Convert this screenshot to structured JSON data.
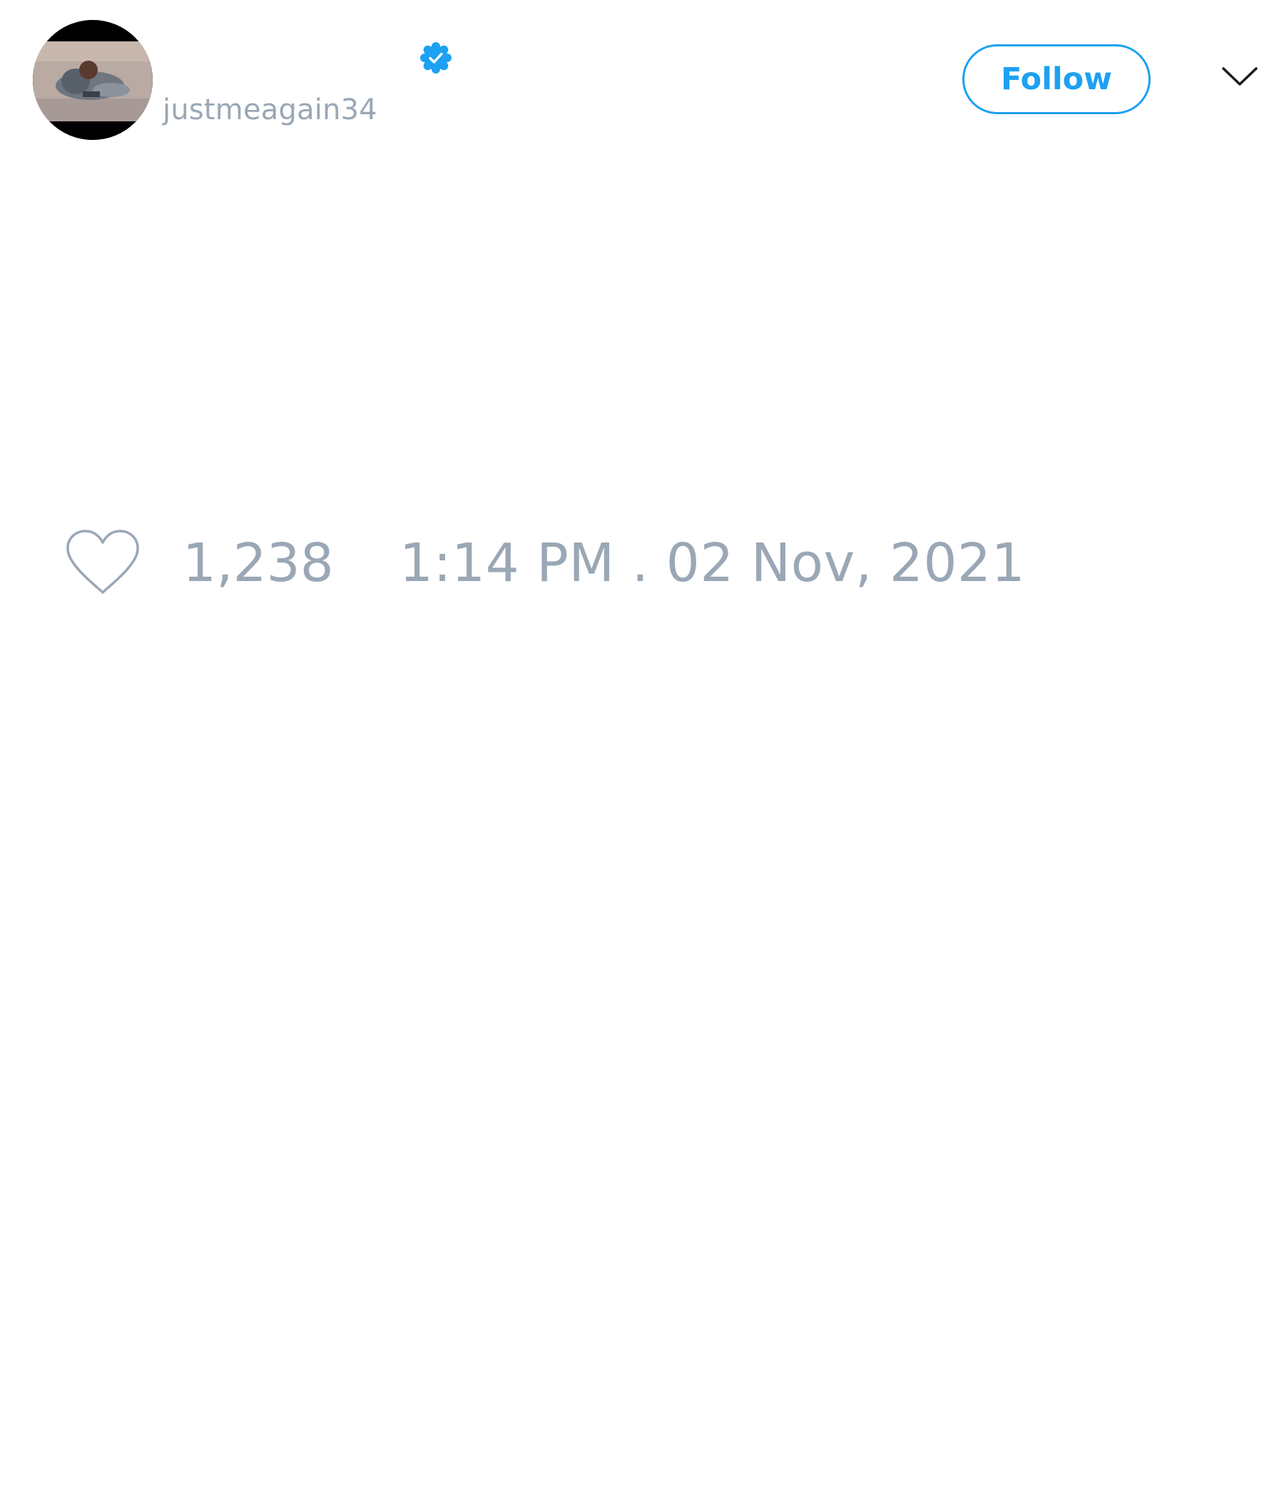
{
  "tweet": {
    "author": {
      "display_name": "",
      "handle": "justmeagain34",
      "verified": true,
      "avatar_icon": "avatar-photo"
    },
    "follow_label": "Follow",
    "menu_icon": "chevron-down-icon",
    "footer": {
      "like_icon": "heart-outline-icon",
      "like_count": "1,238",
      "timestamp": "1:14 PM . 02 Nov, 2021"
    }
  },
  "colors": {
    "accent": "#1da1f2",
    "muted_text": "#9aa7b5",
    "background": "#ffffff"
  }
}
